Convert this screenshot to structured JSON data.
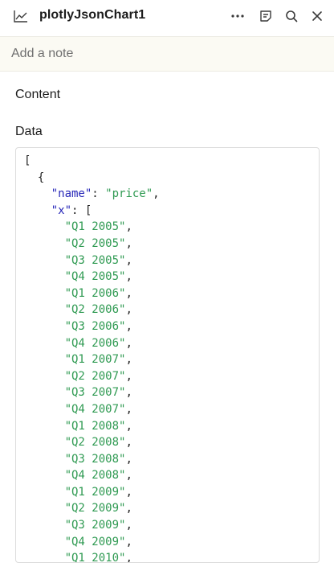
{
  "header": {
    "title": "plotlyJsonChart1",
    "type_icon": "line-chart-icon",
    "actions": [
      {
        "name": "more-icon"
      },
      {
        "name": "notes-icon"
      },
      {
        "name": "search-icon"
      },
      {
        "name": "close-icon"
      }
    ]
  },
  "note": {
    "placeholder": "Add a note"
  },
  "content": {
    "section_title": "Content",
    "data_label": "Data"
  },
  "code": {
    "open_array": "[",
    "open_object": "{",
    "name_key": "\"name\"",
    "name_value": "\"price\"",
    "x_key": "\"x\"",
    "x_open": "[",
    "x_values": [
      "\"Q1 2005\"",
      "\"Q2 2005\"",
      "\"Q3 2005\"",
      "\"Q4 2005\"",
      "\"Q1 2006\"",
      "\"Q2 2006\"",
      "\"Q3 2006\"",
      "\"Q4 2006\"",
      "\"Q1 2007\"",
      "\"Q2 2007\"",
      "\"Q3 2007\"",
      "\"Q4 2007\"",
      "\"Q1 2008\"",
      "\"Q2 2008\"",
      "\"Q3 2008\"",
      "\"Q4 2008\"",
      "\"Q1 2009\"",
      "\"Q2 2009\"",
      "\"Q3 2009\"",
      "\"Q4 2009\"",
      "\"Q1 2010\""
    ]
  }
}
